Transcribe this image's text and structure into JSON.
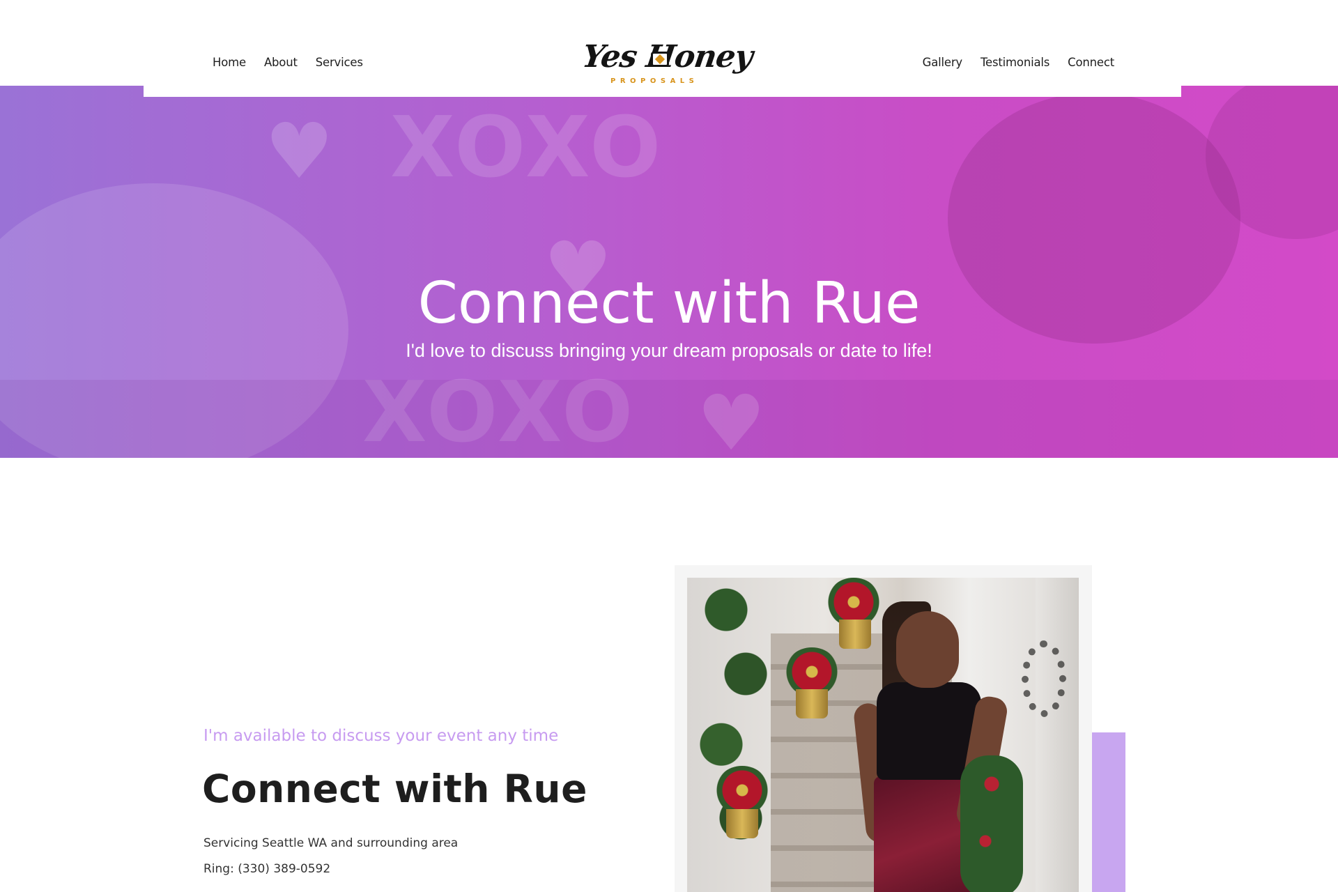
{
  "header": {
    "nav_left": [
      "Home",
      "About",
      "Services"
    ],
    "nav_right": [
      "Gallery",
      "Testimonials",
      "Connect"
    ],
    "logo": {
      "script": "Yes Honey",
      "sub": "PROPOSALS"
    }
  },
  "hero": {
    "title": "Connect with Rue",
    "subtitle": "I'd love to discuss bringing your dream proposals or date to life!"
  },
  "content": {
    "eyebrow": "I'm available to discuss your event any time",
    "title": "Connect with Rue",
    "lines": [
      "Servicing Seattle WA and surrounding area",
      "Ring: (330) 389-0592"
    ]
  },
  "colors": {
    "accent": "#c8a6f0",
    "eyebrow": "#c79bf0",
    "logo_gold": "#d8941c",
    "hero_start": "#9a72d6",
    "hero_end": "#d34ac8"
  }
}
